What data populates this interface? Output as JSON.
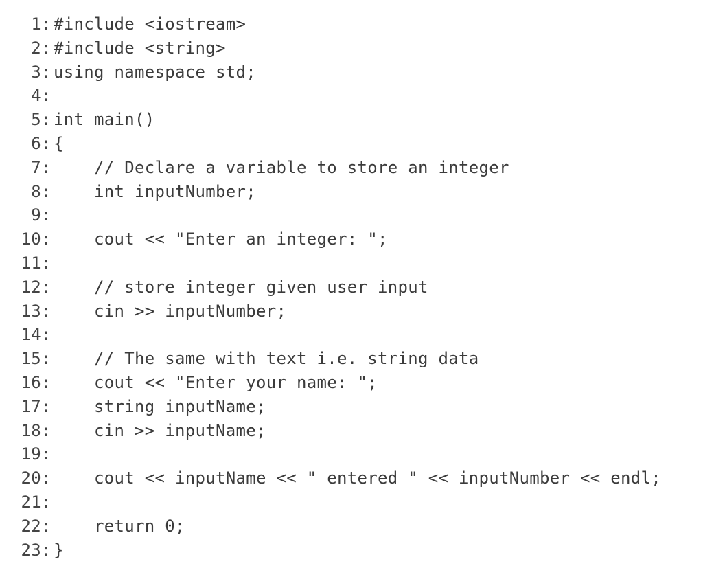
{
  "document": {
    "kind": "source-code-listing",
    "language": "C++",
    "background_color": "#ffffff",
    "text_color": "#3b3b3b",
    "line_number_separator": ":",
    "total_lines": 23
  },
  "lines": [
    {
      "number": "1",
      "code": "#include <iostream>"
    },
    {
      "number": "2",
      "code": "#include <string>"
    },
    {
      "number": "3",
      "code": "using namespace std;"
    },
    {
      "number": "4",
      "code": ""
    },
    {
      "number": "5",
      "code": "int main()"
    },
    {
      "number": "6",
      "code": "{"
    },
    {
      "number": "7",
      "code": "    // Declare a variable to store an integer"
    },
    {
      "number": "8",
      "code": "    int inputNumber;"
    },
    {
      "number": "9",
      "code": ""
    },
    {
      "number": "10",
      "code": "    cout << \"Enter an integer: \";"
    },
    {
      "number": "11",
      "code": ""
    },
    {
      "number": "12",
      "code": "    // store integer given user input"
    },
    {
      "number": "13",
      "code": "    cin >> inputNumber;"
    },
    {
      "number": "14",
      "code": ""
    },
    {
      "number": "15",
      "code": "    // The same with text i.e. string data"
    },
    {
      "number": "16",
      "code": "    cout << \"Enter your name: \";"
    },
    {
      "number": "17",
      "code": "    string inputName;"
    },
    {
      "number": "18",
      "code": "    cin >> inputName;"
    },
    {
      "number": "19",
      "code": ""
    },
    {
      "number": "20",
      "code": "    cout << inputName << \" entered \" << inputNumber << endl;"
    },
    {
      "number": "21",
      "code": ""
    },
    {
      "number": "22",
      "code": "    return 0;"
    },
    {
      "number": "23",
      "code": "}"
    }
  ]
}
